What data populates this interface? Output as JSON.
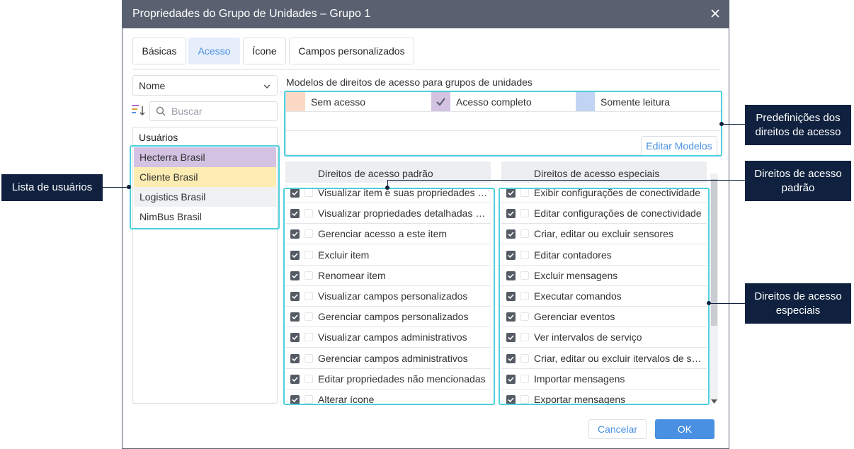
{
  "dialog": {
    "title": "Propriedades do Grupo de Unidades – Grupo 1",
    "tabs": [
      {
        "label": "Básicas",
        "active": false
      },
      {
        "label": "Acesso",
        "active": true
      },
      {
        "label": "Ícone",
        "active": false
      },
      {
        "label": "Campos personalizados",
        "active": false
      }
    ]
  },
  "left": {
    "sort_value": "Nome",
    "search_placeholder": "Buscar",
    "users_header": "Usuários",
    "users": [
      {
        "label": "Hecterra Brasil",
        "color": "#d4c2e3"
      },
      {
        "label": "Cliente Brasil",
        "color": "#fdedb3"
      },
      {
        "label": "Logistics Brasil",
        "color": "#eff1f3"
      },
      {
        "label": "NimBus Brasil",
        "color": "#ffffff"
      }
    ]
  },
  "models": {
    "label": "Modelos de direitos de acesso para grupos de unidades",
    "items": [
      {
        "label": "Sem acesso",
        "color": "#fcd9c4"
      },
      {
        "label": "Acesso completo",
        "color": "#d4c2e3"
      },
      {
        "label": "Somente leitura",
        "color": "#c2d4f3"
      }
    ],
    "edit_label": "Editar Modelos"
  },
  "rights": {
    "standard_header": "Direitos de acesso padrão",
    "special_header": "Direitos de acesso especiais",
    "standard": [
      "Visualizar item e suas propriedades básicas",
      "Visualizar propriedades detalhadas do item",
      "Gerenciar acesso a este item",
      "Excluir item",
      "Renomear item",
      "Visualizar campos personalizados",
      "Gerenciar campos personalizados",
      "Visualizar campos administrativos",
      "Gerenciar campos administrativos",
      "Editar propriedades não mencionadas",
      "Alterar ícone"
    ],
    "special": [
      "Exibir configurações de conectividade",
      "Editar configurações de conectividade",
      "Criar, editar ou excluir sensores",
      "Editar contadores",
      "Excluir mensagens",
      "Executar comandos",
      "Gerenciar eventos",
      "Ver intervalos de serviço",
      "Criar, editar ou excluir itervalos de serviço",
      "Importar mensagens",
      "Exportar mensagens"
    ]
  },
  "footer": {
    "cancel_label": "Cancelar",
    "ok_label": "OK"
  },
  "callouts": {
    "users": "Lista de usuários",
    "presets": "Predefinições dos direitos de acesso",
    "standard": "Direitos de acesso padrão",
    "special": "Direitos de acesso especiais"
  },
  "colors": {
    "accent": "#4a90e2",
    "highlight": "#4fd0dc",
    "callout_bg": "#10213f",
    "titlebar": "#596170"
  }
}
